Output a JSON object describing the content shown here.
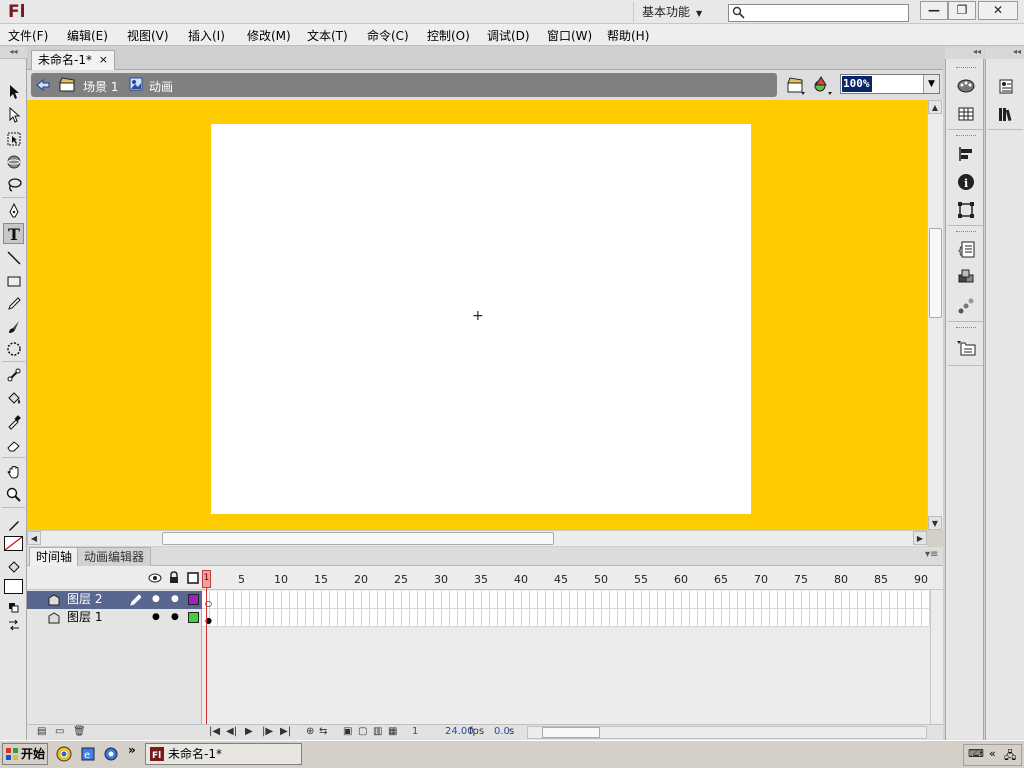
{
  "app": {
    "logo": "Fl",
    "workspace": "基本功能",
    "search_placeholder": "",
    "window_buttons": {
      "minimize": "—",
      "restore": "❐",
      "close": "✕"
    }
  },
  "menu": [
    "文件(F)",
    "编辑(E)",
    "视图(V)",
    "插入(I)",
    "修改(M)",
    "文本(T)",
    "命令(C)",
    "控制(O)",
    "调试(D)",
    "窗口(W)",
    "帮助(H)"
  ],
  "document": {
    "tab_title": "未命名-1*",
    "tab_close": "×",
    "scene": "场景 1",
    "symbol": "动画",
    "zoom": "100%"
  },
  "colors": {
    "pasteboard": "#ffcc00",
    "stage": "#ffffff",
    "layer_selected": "#59668f",
    "layer2_color": "#a020c0",
    "layer1_color": "#40d040",
    "playhead": "#d03030"
  },
  "tools": [
    "selection-arrow-icon",
    "subselection-icon",
    "free-transform-icon",
    "3d-rotation-icon",
    "lasso-icon",
    "pen-icon",
    "text-icon",
    "line-icon",
    "rectangle-icon",
    "pencil-icon",
    "brush-icon",
    "deco-icon",
    "bone-icon",
    "paint-bucket-icon",
    "eyedropper-icon",
    "eraser-icon",
    "hand-icon",
    "zoom-icon",
    "stroke-color-icon",
    "fill-color-icon",
    "black-white-icon",
    "swap-colors-icon"
  ],
  "timeline": {
    "tabs": [
      "时间轴",
      "动画编辑器"
    ],
    "frame_numbers": [
      "1",
      "5",
      "10",
      "15",
      "20",
      "25",
      "30",
      "35",
      "40",
      "45",
      "50",
      "55",
      "60",
      "65",
      "70",
      "75",
      "80",
      "85",
      "90"
    ],
    "layers": [
      {
        "name": "图层 2",
        "selected": true
      },
      {
        "name": "图层 1",
        "selected": false
      }
    ],
    "current_frame": "1",
    "fps": "24.00",
    "fps_unit": "fps",
    "time": "0.0",
    "time_unit": "s"
  },
  "right_panels": [
    "color-icon",
    "swatches-icon",
    "align-icon",
    "info-icon",
    "transform-icon",
    "actions-icon",
    "components-icon",
    "motion-presets-icon",
    "library-icon",
    "properties-icon",
    "library2-icon"
  ],
  "taskbar": {
    "start": "开始",
    "task": "未命名-1*"
  }
}
